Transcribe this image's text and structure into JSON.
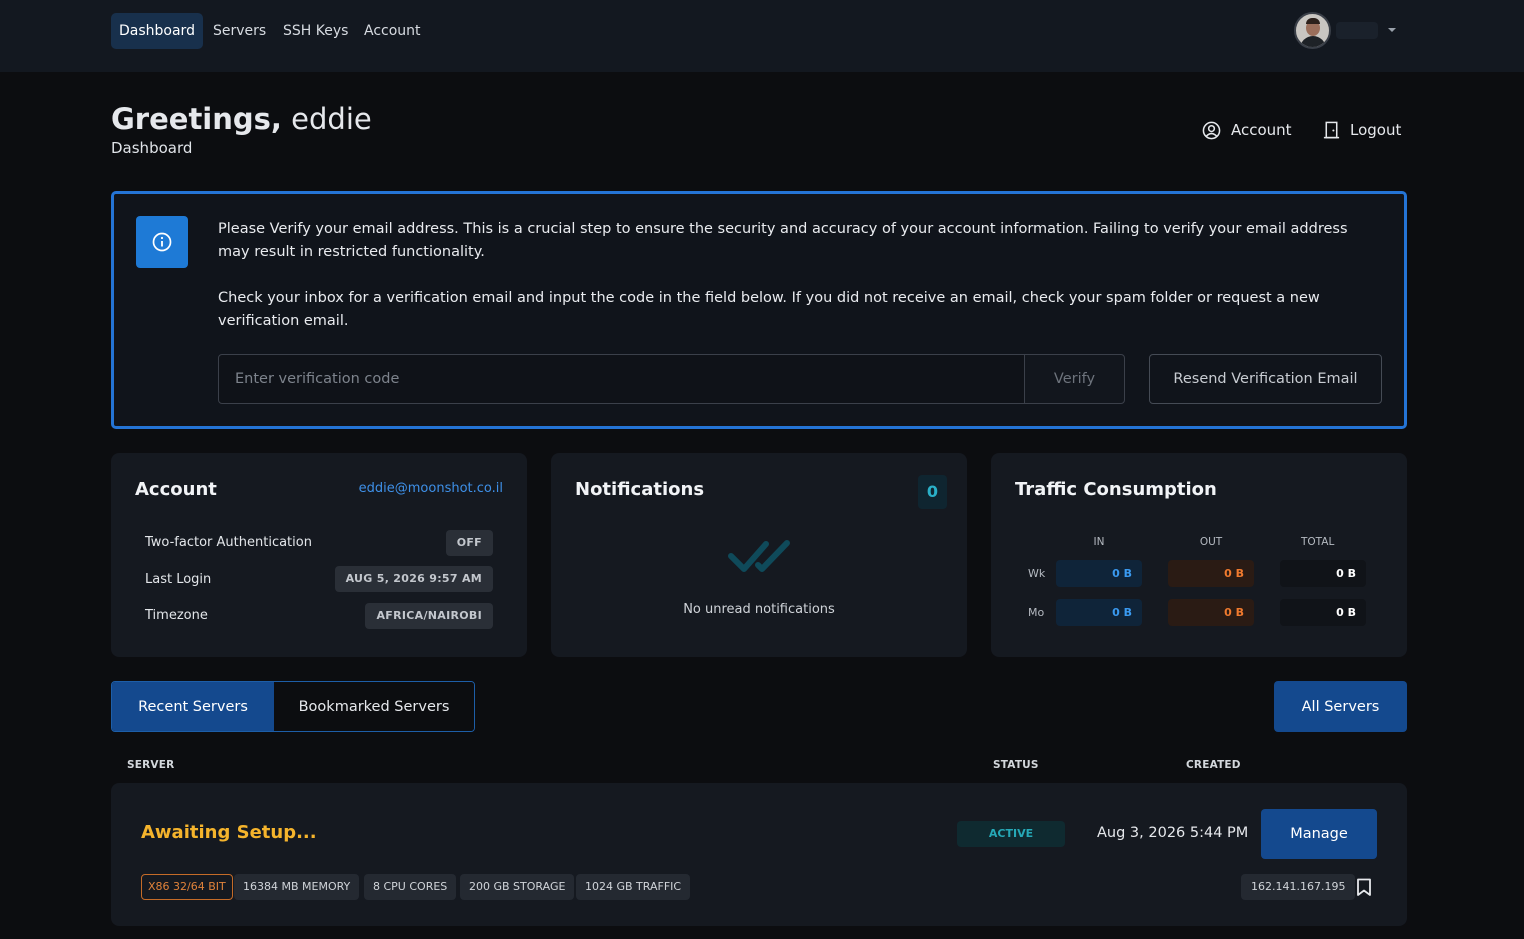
{
  "nav": {
    "items": [
      {
        "label": "Dashboard",
        "active": true
      },
      {
        "label": "Servers"
      },
      {
        "label": "SSH Keys"
      },
      {
        "label": "Account"
      }
    ]
  },
  "header": {
    "greeting_bold": "Greetings,",
    "greeting_name": "eddie",
    "breadcrumb": "Dashboard",
    "account_link": "Account",
    "logout_link": "Logout"
  },
  "alert": {
    "paragraph1": "Please Verify your email address. This is a crucial step to ensure the security and accuracy of your account information. Failing to verify your email address may result in restricted functionality.",
    "paragraph2": "Check your inbox for a verification email and input the code in the field below. If you did not receive an email, check your spam folder or request a new verification email.",
    "code_placeholder": "Enter verification code",
    "code_value": "",
    "verify_label": "Verify",
    "resend_label": "Resend Verification Email"
  },
  "account_card": {
    "title": "Account",
    "email": "eddie@moonshot.co.il",
    "rows": [
      {
        "label": "Two-factor Authentication",
        "value": "OFF"
      },
      {
        "label": "Last Login",
        "value": "AUG 5, 2026 9:57 AM"
      },
      {
        "label": "Timezone",
        "value": "AFRICA/NAIROBI"
      }
    ]
  },
  "notifications_card": {
    "title": "Notifications",
    "count": "0",
    "empty_text": "No unread notifications"
  },
  "traffic_card": {
    "title": "Traffic Consumption",
    "headers": {
      "in": "IN",
      "out": "OUT",
      "total": "TOTAL"
    },
    "rows": [
      {
        "label": "Wk",
        "in": "0 B",
        "out": "0 B",
        "total": "0 B"
      },
      {
        "label": "Mo",
        "in": "0 B",
        "out": "0 B",
        "total": "0 B"
      }
    ]
  },
  "servers": {
    "tab_recent": "Recent Servers",
    "tab_bookmarked": "Bookmarked Servers",
    "all_servers_label": "All Servers",
    "columns": {
      "server": "SERVER",
      "status": "STATUS",
      "created": "CREATED"
    },
    "list": [
      {
        "name": "Awaiting Setup...",
        "status": "ACTIVE",
        "created": "Aug 3, 2026 5:44 PM",
        "manage_label": "Manage",
        "specs": {
          "arch": "X86 32/64 BIT",
          "memory": "16384 MB MEMORY",
          "cpu": "8 CPU CORES",
          "storage": "200 GB STORAGE",
          "traffic": "1024 GB TRAFFIC"
        },
        "ip": "162.141.167.195"
      }
    ]
  },
  "colors": {
    "accent_blue": "#14498e",
    "alert_border": "#2474d6",
    "server_name": "#f5b42c",
    "status_active": "#26a9b7"
  },
  "icons": {
    "alert": "info-icon",
    "account": "user-circle-icon",
    "logout": "door-icon",
    "notifications_empty": "double-check-icon",
    "bookmark": "bookmark-icon",
    "user_menu": "chevron-down-icon"
  }
}
